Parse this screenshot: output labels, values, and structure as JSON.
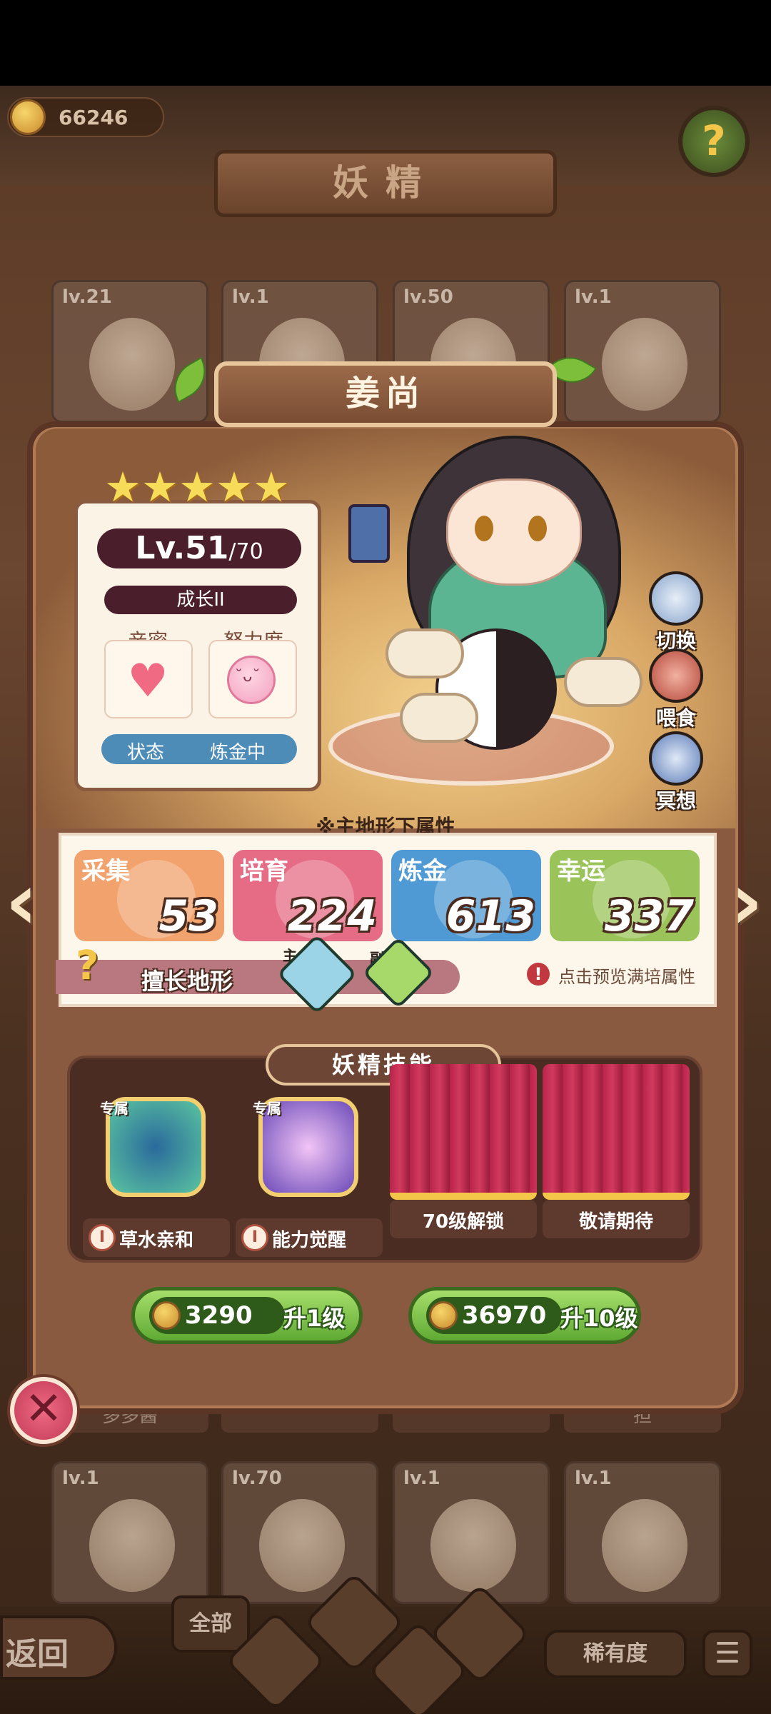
{
  "header": {
    "currency_value": "66246",
    "title": "妖精",
    "help_icon": "question-mark-icon"
  },
  "background_cards": {
    "top_row": [
      {
        "level": "lv.21"
      },
      {
        "level": "lv.1"
      },
      {
        "level": "lv.50"
      },
      {
        "level": "lv.1"
      }
    ],
    "names_row": [
      {
        "name": "多多酱"
      },
      {
        "name": ""
      },
      {
        "name": ""
      },
      {
        "name": "担"
      }
    ],
    "bottom_row": [
      {
        "level": "lv.1"
      },
      {
        "level": "lv.70"
      },
      {
        "level": "lv.1"
      },
      {
        "level": "lv.1"
      }
    ]
  },
  "fairy": {
    "name": "姜尚",
    "stars": 5,
    "level": "Lv.51",
    "level_max": "/70",
    "growth": "成长II",
    "intimacy_label": "亲密",
    "effort_label": "努力度",
    "state_label": "状态",
    "state_value": "炼金中"
  },
  "side_actions": {
    "switch": "切换",
    "feed": "喂食",
    "meditate": "冥想"
  },
  "attributes": {
    "caption": "※主地形下属性",
    "items": [
      {
        "label": "采集",
        "value": "53",
        "color": "#f2a26c"
      },
      {
        "label": "培育",
        "value": "224",
        "color": "#e66c86"
      },
      {
        "label": "炼金",
        "value": "613",
        "color": "#4f9ad4"
      },
      {
        "label": "幸运",
        "value": "337",
        "color": "#9ac45a"
      }
    ],
    "terrain_label": "擅长地形",
    "terrain_main_tag": "主",
    "terrain_sub_tag": "副",
    "preview_hint": "点击预览满培属性"
  },
  "skills": {
    "header": "妖精技能",
    "items": [
      {
        "tag": "专属",
        "label": "草水亲和",
        "locked": false
      },
      {
        "tag": "专属",
        "label": "能力觉醒",
        "locked": false
      },
      {
        "tag": "",
        "label": "70级解锁",
        "locked": true
      },
      {
        "tag": "",
        "label": "敬请期待",
        "locked": true
      }
    ]
  },
  "upgrade": {
    "one": {
      "cost": "3290",
      "label": "升1级"
    },
    "ten": {
      "cost": "36970",
      "label": "升10级"
    }
  },
  "bottom_nav": {
    "back": "返回",
    "all": "全部",
    "rarity": "稀有度"
  }
}
